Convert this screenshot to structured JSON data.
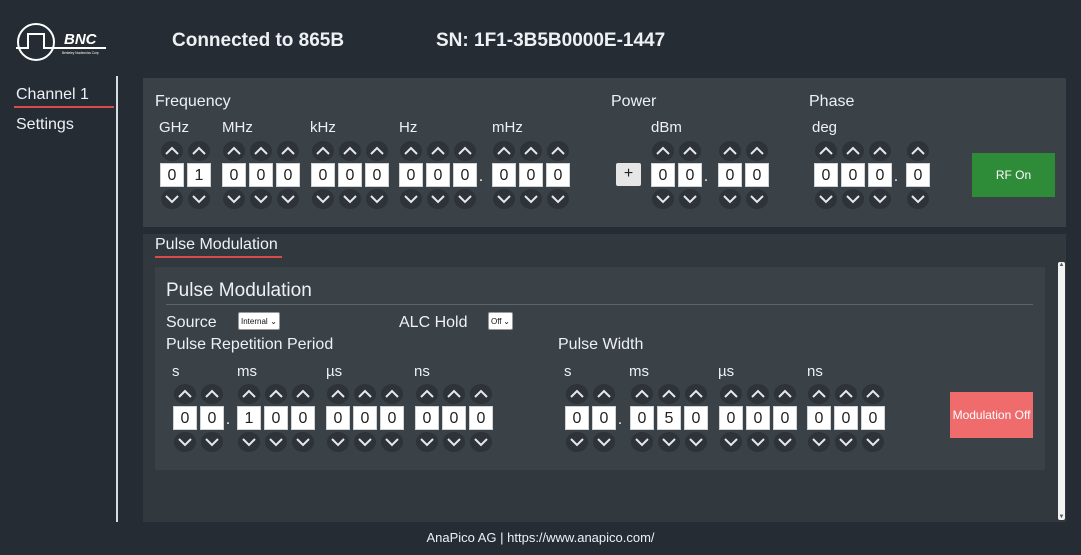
{
  "header": {
    "logo_text": "BNC",
    "logo_subtext": "Berkeley Nucleonics Corp",
    "connection": "Connected to 865B",
    "serial": "SN: 1F1-3B5B0000E-1447"
  },
  "sidebar": {
    "items": [
      {
        "label": "Channel 1",
        "active": true
      },
      {
        "label": "Settings",
        "active": false
      }
    ]
  },
  "rf": {
    "frequency": {
      "title": "Frequency",
      "units": [
        "GHz",
        "MHz",
        "kHz",
        "Hz",
        "mHz"
      ],
      "groups": [
        [
          "0",
          "1"
        ],
        [
          "0",
          "0",
          "0"
        ],
        [
          "0",
          "0",
          "0"
        ],
        [
          "0",
          "0",
          "0"
        ],
        [
          "0",
          "0",
          "0"
        ]
      ]
    },
    "power": {
      "title": "Power",
      "unit": "dBm",
      "sign": "+",
      "groups": [
        [
          "0",
          "0"
        ],
        [
          "0",
          "0"
        ]
      ]
    },
    "phase": {
      "title": "Phase",
      "unit": "deg",
      "groups": [
        [
          "0",
          "0",
          "0"
        ],
        [
          "0"
        ]
      ]
    },
    "rf_button": "RF On"
  },
  "pulse": {
    "tab_label": "Pulse Modulation",
    "title": "Pulse Modulation",
    "source_label": "Source",
    "source_value": "Internal",
    "alc_label": "ALC Hold",
    "alc_value": "Off",
    "prp": {
      "title": "Pulse Repetition Period",
      "units": [
        "s",
        "ms",
        "µs",
        "ns"
      ],
      "groups": [
        [
          "0",
          "0"
        ],
        [
          "1",
          "0",
          "0"
        ],
        [
          "0",
          "0",
          "0"
        ],
        [
          "0",
          "0",
          "0"
        ]
      ]
    },
    "pw": {
      "title": "Pulse Width",
      "units": [
        "s",
        "ms",
        "µs",
        "ns"
      ],
      "groups": [
        [
          "0",
          "0"
        ],
        [
          "0",
          "5",
          "0"
        ],
        [
          "0",
          "0",
          "0"
        ],
        [
          "0",
          "0",
          "0"
        ]
      ]
    },
    "mod_button": "Modulation Off"
  },
  "footer": "AnaPico AG | https://www.anapico.com/",
  "colors": {
    "background": "#252c33",
    "panel": "#3a4147",
    "rf_on": "#2e8b38",
    "modulation_off": "#f06b6b",
    "accent_underline": "#d94a4a"
  }
}
